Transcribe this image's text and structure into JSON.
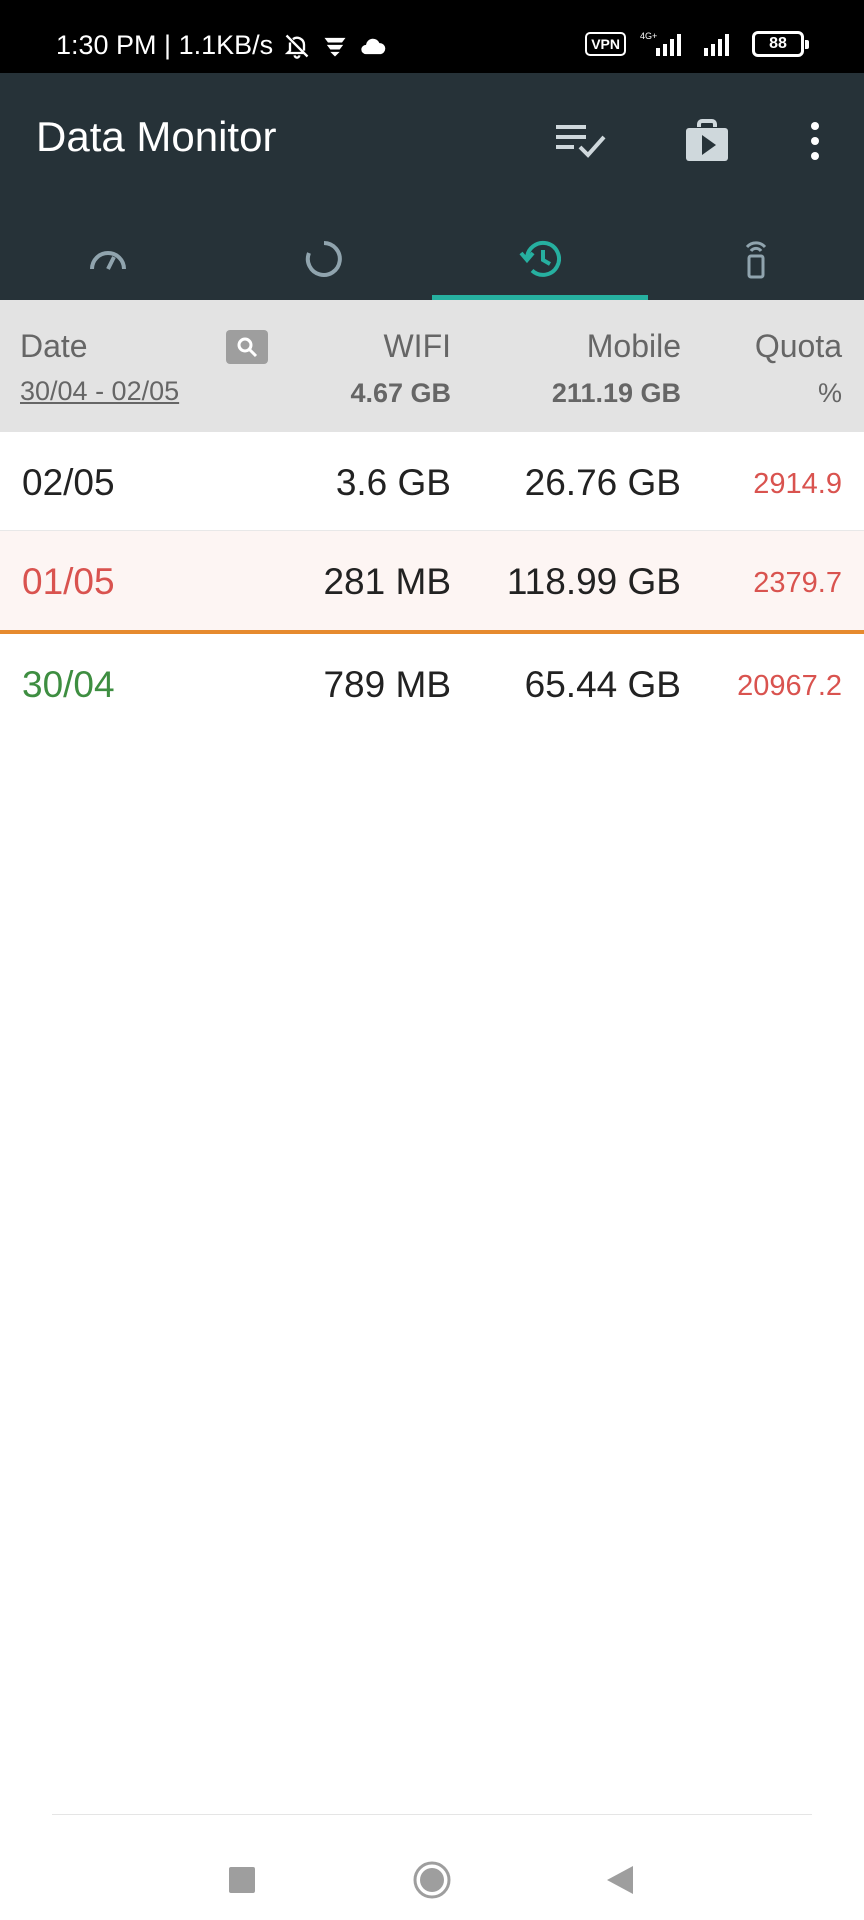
{
  "status_bar": {
    "time_speed": "1:30 PM | 1.1KB/s",
    "vpn": "VPN",
    "network_type": "4G+",
    "battery": "88"
  },
  "app_bar": {
    "title": "Data Monitor",
    "actions": [
      "checklist-icon",
      "store-icon",
      "more-vert-icon"
    ]
  },
  "tabs": [
    {
      "icon": "speedometer-icon",
      "active": false
    },
    {
      "icon": "circular-progress-icon",
      "active": false
    },
    {
      "icon": "history-icon",
      "active": true
    },
    {
      "icon": "phone-signal-icon",
      "active": false
    }
  ],
  "table": {
    "header": {
      "date_label": "Date",
      "date_range": "30/04 - 02/05",
      "wifi_label": "WIFI",
      "wifi_total": "4.67 GB",
      "mobile_label": "Mobile",
      "mobile_total": "211.19 GB",
      "quota_label": "Quota",
      "quota_unit": "%"
    },
    "rows": [
      {
        "date": "02/05",
        "wifi": "3.6 GB",
        "mobile": "26.76 GB",
        "quota": "2914.9"
      },
      {
        "date": "01/05",
        "wifi": "281 MB",
        "mobile": "118.99 GB",
        "quota": "2379.7"
      },
      {
        "date": "30/04",
        "wifi": "789 MB",
        "mobile": "65.44 GB",
        "quota": "20967.2"
      }
    ]
  },
  "colors": {
    "app_bar": "#263238",
    "tab_indicator": "#26b0a0",
    "over_quota": "#d9534f",
    "current_day": "#3e8e41",
    "separator": "#e68a2e"
  }
}
